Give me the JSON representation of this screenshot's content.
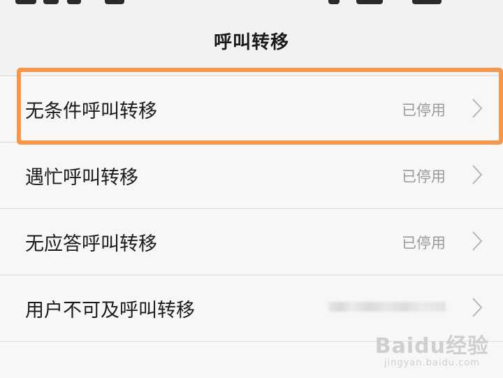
{
  "header": {
    "title": "呼叫转移"
  },
  "rows": [
    {
      "label": "无条件呼叫转移",
      "status": "已停用"
    },
    {
      "label": "遇忙呼叫转移",
      "status": "已停用"
    },
    {
      "label": "无应答呼叫转移",
      "status": "已停用"
    },
    {
      "label": "用户不可及呼叫转移",
      "status": ""
    }
  ],
  "highlight_color": "#f5964a",
  "watermark": {
    "main": "Baidu经验",
    "sub": "jingyan.baidu.com"
  },
  "icons": {
    "row_arrow": "chevron-right-icon"
  }
}
